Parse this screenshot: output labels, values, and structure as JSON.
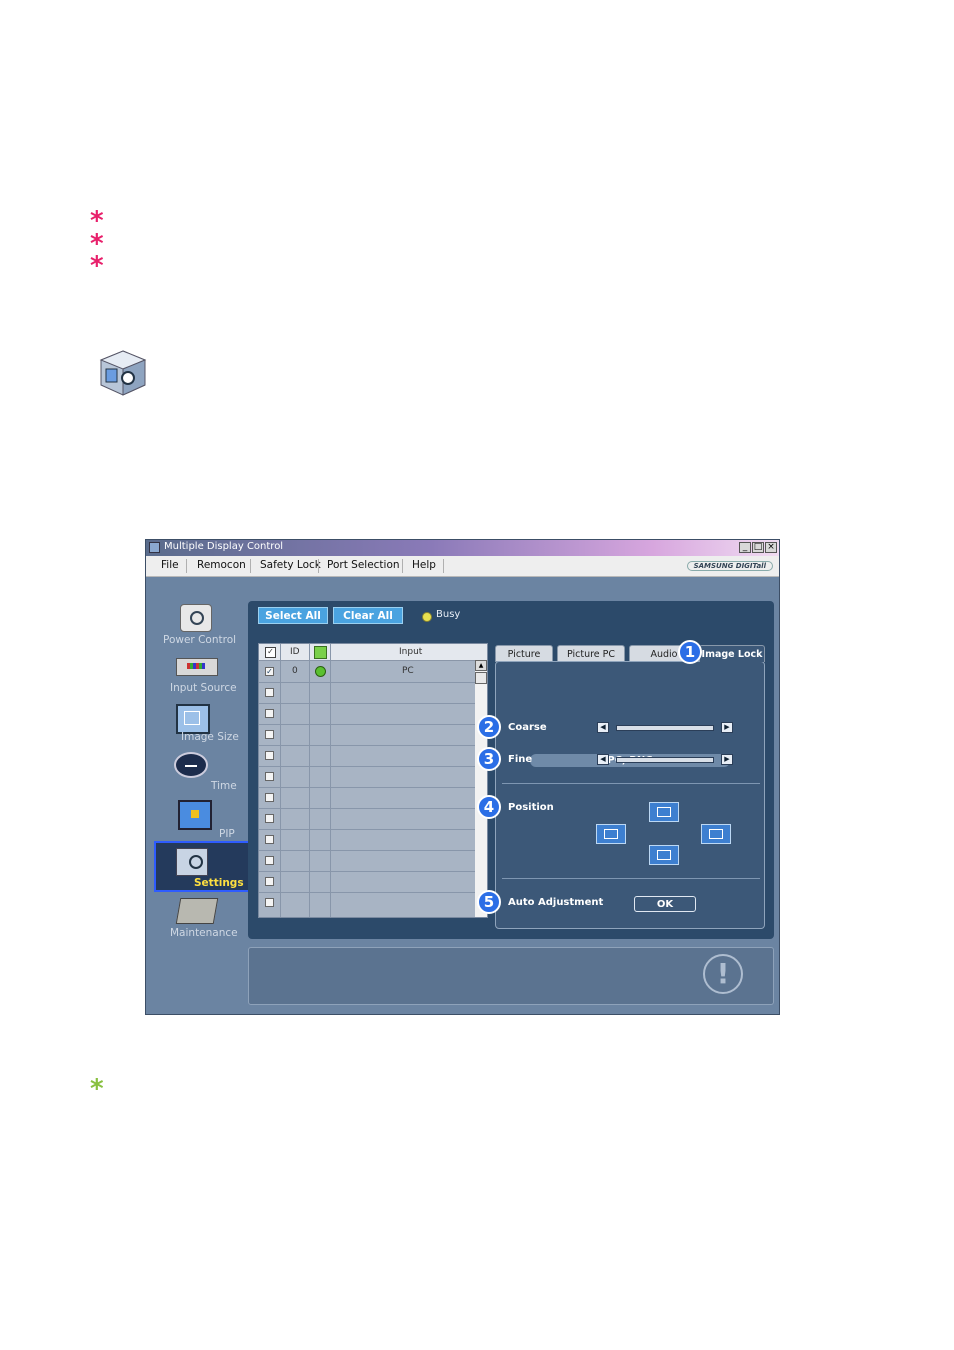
{
  "window": {
    "title": "Multiple Display Control",
    "brand": "SAMSUNG DIGITall"
  },
  "menu": [
    "File",
    "Remocon",
    "Safety Lock",
    "Port Selection",
    "Help"
  ],
  "sidebar": [
    {
      "label": "Power Control",
      "icon": "power-control-icon"
    },
    {
      "label": "Input Source",
      "icon": "input-source-icon"
    },
    {
      "label": "Image Size",
      "icon": "image-size-icon"
    },
    {
      "label": "Time",
      "icon": "clock-icon"
    },
    {
      "label": "PIP",
      "icon": "pip-icon"
    },
    {
      "label": "Settings",
      "icon": "settings-icon"
    },
    {
      "label": "Maintenance",
      "icon": "maintenance-icon"
    }
  ],
  "toolbar": {
    "select_all": "Select All",
    "clear_all": "Clear All",
    "busy": "Busy"
  },
  "grid": {
    "headers": {
      "id": "ID",
      "input": "Input"
    },
    "row0": {
      "id": "0",
      "input": "PC"
    }
  },
  "tabs": [
    "Picture",
    "Picture PC",
    "Audio",
    "Image Lock"
  ],
  "image_lock": {
    "source": "PC, BNC",
    "coarse": "Coarse",
    "fine": "Fine",
    "position": "Position",
    "auto_adjustment": "Auto Adjustment",
    "ok": "OK"
  },
  "badges": [
    "1",
    "2",
    "3",
    "4",
    "5"
  ]
}
